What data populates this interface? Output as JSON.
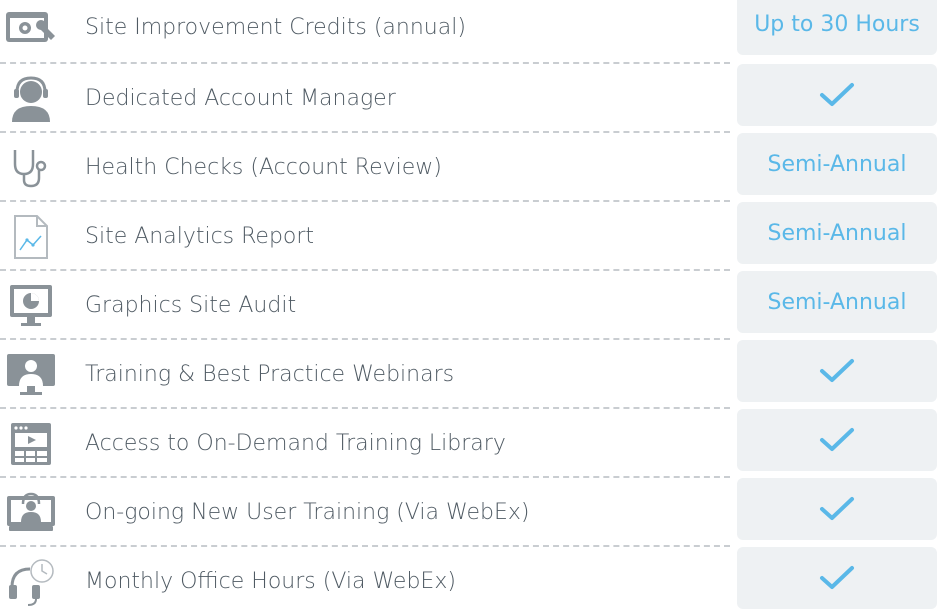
{
  "colors": {
    "accent": "#5ab8e8",
    "icon": "#8a9298",
    "cell_bg": "#eef1f3",
    "text": "#4f5a63"
  },
  "rows": [
    {
      "label": "Site Improvement Credits (annual)",
      "value": "Up to 30 Hours",
      "icon": "gear-wrench-icon"
    },
    {
      "label": "Dedicated Account Manager",
      "value": "",
      "check": true,
      "icon": "account-manager-headset-icon"
    },
    {
      "label": "Health Checks (Account Review)",
      "value": "Semi-Annual",
      "icon": "stethoscope-icon"
    },
    {
      "label": "Site Analytics Report",
      "value": "Semi-Annual",
      "icon": "analytics-report-icon"
    },
    {
      "label": "Graphics Site Audit",
      "value": "Semi-Annual",
      "icon": "monitor-pie-chart-icon"
    },
    {
      "label": "Training & Best Practice Webinars",
      "value": "",
      "check": true,
      "icon": "webinar-presenter-icon"
    },
    {
      "label": "Access to On-Demand Training Library",
      "value": "",
      "check": true,
      "icon": "video-library-icon"
    },
    {
      "label": "On-going New User Training (Via WebEx)",
      "value": "",
      "check": true,
      "icon": "webex-training-icon"
    },
    {
      "label": "Monthly Office Hours (Via WebEx)",
      "value": "",
      "check": true,
      "icon": "headset-clock-icon"
    }
  ]
}
